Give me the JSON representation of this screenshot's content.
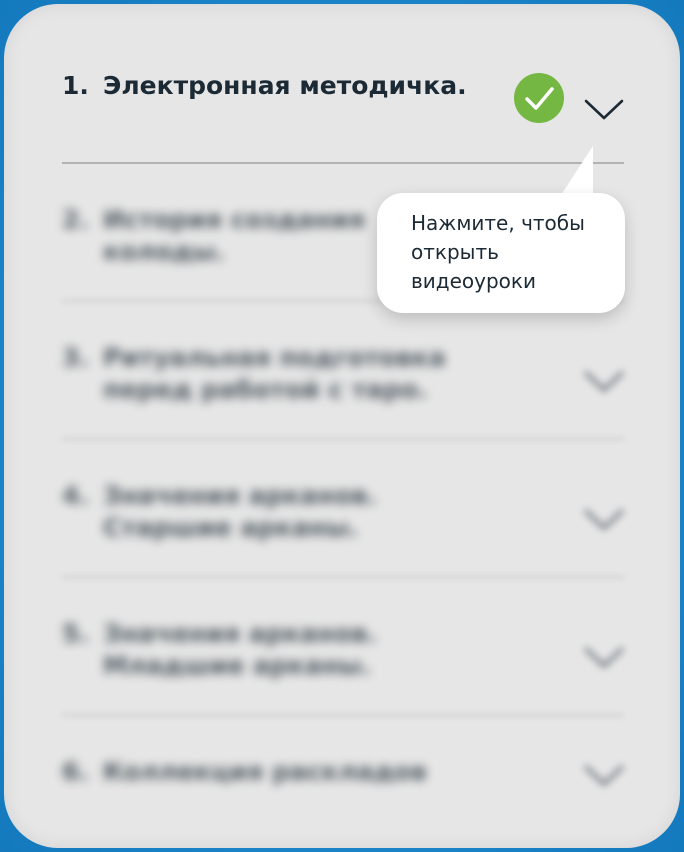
{
  "lessons": [
    {
      "number": "1.",
      "title": "Электронная методичка.",
      "completed": true,
      "expanded": false
    },
    {
      "number": "2.",
      "title": "История создания колоды.",
      "completed": false
    },
    {
      "number": "3.",
      "title": "Ритуальная подготовка перед работой с таро.",
      "completed": false
    },
    {
      "number": "4.",
      "title": "Значения арканов. Старшие арканы.",
      "completed": false
    },
    {
      "number": "5.",
      "title": "Значения арканов. Младшие арканы.",
      "completed": false
    },
    {
      "number": "6.",
      "title": "Коллекция раскладов",
      "completed": false
    }
  ],
  "tooltip": {
    "text": "Нажмите, чтобы открыть видеоуроки"
  },
  "colors": {
    "frame": "#1b86c9",
    "card": "#e6e6e6",
    "check": "#74b843",
    "text": "#1b2a35"
  },
  "icons": {
    "completed": "check-circle-icon",
    "expand": "chevron-down-icon"
  }
}
